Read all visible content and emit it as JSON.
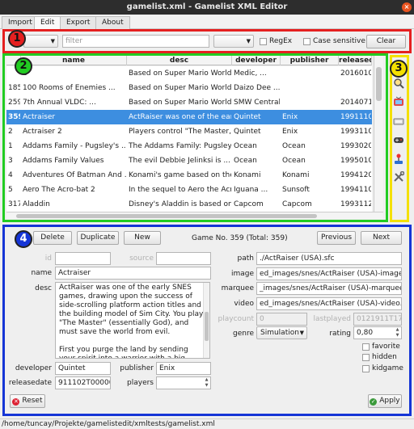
{
  "window": {
    "title": "gamelist.xml - Gamelist XML Editor",
    "close_glyph": "×"
  },
  "menu": {
    "tabs": [
      "Import",
      "Edit",
      "Export",
      "About"
    ]
  },
  "annotations": [
    "1",
    "2",
    "3",
    "4"
  ],
  "filter": {
    "field_value": "",
    "filter_placeholder": "filter",
    "mode_value": "",
    "regex_label": "RegEx",
    "case_label": "Case sensitive",
    "clear_label": "Clear"
  },
  "grid": {
    "columns": [
      "",
      "name",
      "desc",
      "developer",
      "publisher",
      "releasedat"
    ],
    "rows": [
      [
        "",
        "e",
        "Based on Super Mario World...",
        "Medic, ...",
        "",
        "20160105"
      ],
      [
        "185",
        "100 Rooms of Enemies ...",
        "Based on Super Mario World...",
        "Daizo Dee ...",
        "",
        ""
      ],
      [
        "259",
        "7th Annual VLDC: ...",
        "Based on Super Mario World...",
        "SMW Central",
        "",
        "20140711"
      ],
      [
        "359",
        "Actraiser",
        "ActRaiser was one of the early...",
        "Quintet",
        "Enix",
        "19911102T00("
      ],
      [
        "2",
        "Actraiser 2",
        "Players control \"The Master,\"...",
        "Quintet",
        "Enix",
        "19931101T00("
      ],
      [
        "1",
        "Addams Family - Pugsley's ...",
        "The Addams Family: Pugsley'...",
        "Ocean",
        "Ocean",
        "19930201T00("
      ],
      [
        "3",
        "Addams Family Values",
        "The evil Debbie Jelinksi is ...",
        "Ocean",
        "Ocean",
        "19950101T00("
      ],
      [
        "4",
        "Adventures Of Batman And ...",
        "Konami's game based on the...",
        "Konami",
        "Konami",
        "19941201T00("
      ],
      [
        "5",
        "Aero The Acro-bat 2",
        "In the sequel to Aero the Acr...",
        "Iguana ...",
        "Sunsoft",
        "19941101T00("
      ],
      [
        "317",
        "Aladdin",
        "Disney's Aladdin is based on ...",
        "Capcom",
        "Capcom",
        "19931121T00("
      ]
    ],
    "selected_index": 3
  },
  "side_icons": [
    "search-icon",
    "tv-icon",
    "cartridge-icon",
    "gamepad-icon",
    "joystick-icon",
    "tools-icon"
  ],
  "detail": {
    "delete_label": "Delete",
    "duplicate_label": "Duplicate",
    "new_label": "New",
    "game_counter": "Game No. 359 (Total: 359)",
    "previous_label": "Previous",
    "next_label": "Next",
    "id_label": "id",
    "id_value": "",
    "source_label": "source",
    "source_value": "",
    "name_label": "name",
    "name_value": "Actraiser",
    "desc_label": "desc",
    "desc_p1": "ActRaiser was one of the early SNES games, drawing upon the success of side-scrolling platform action titles and the building model of Sim City. You play \"The Master\" (essentially God), and must save the world from evil.",
    "desc_p2": "First you purge the land by sending your spirit into a warrior with a big sword and",
    "developer_label": "developer",
    "developer_value": "Quintet",
    "publisher_label": "publisher",
    "publisher_value": "Enix",
    "releasedate_label": "releasedate",
    "releasedate_value": "911102T000000",
    "players_label": "players",
    "players_value": "",
    "path_label": "path",
    "path_value": "./ActRaiser (USA).sfc",
    "image_label": "image",
    "image_value": "ed_images/snes/ActRaiser (USA)-image.jpg",
    "marquee_label": "marquee",
    "marquee_value": "_images/snes/ActRaiser (USA)-marquee.png",
    "video_label": "video",
    "video_value": "ed_images/snes/ActRaiser (USA)-video.mp4",
    "playcount_label": "playcount",
    "playcount_value": "0",
    "lastplayed_label": "lastplayed",
    "lastplayed_value": "0121911T175815",
    "genre_label": "genre",
    "genre_value": "Simulation",
    "rating_label": "rating",
    "rating_value": "0,80",
    "favorite_label": "favorite",
    "hidden_label": "hidden",
    "kidgame_label": "kidgame",
    "reset_label": "Reset",
    "apply_label": "Apply"
  },
  "status": {
    "path": "/home/tuncay/Projekte/gamelistedit/xmltests/gamelist.xml"
  },
  "colors": {
    "annot1": "#e52020",
    "annot2": "#22cc22",
    "annot3": "#f4e000",
    "annot4": "#1535d6",
    "selection": "#3d8ee0"
  }
}
